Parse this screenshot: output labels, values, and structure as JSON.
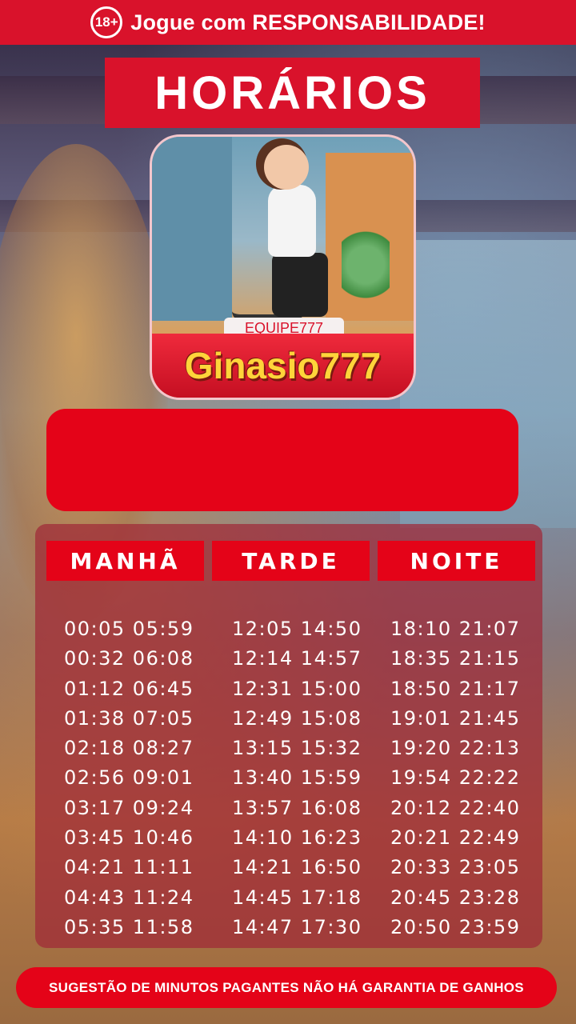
{
  "top_bar": {
    "age_badge": "18+",
    "text": "Jogue com RESPONSABILIDADE!"
  },
  "title": "HORÁRIOS",
  "logo": {
    "ribbon": "EQUIPE777",
    "name": "Ginasio777"
  },
  "colors": {
    "brand_red": "#d9122b",
    "logo_text": "#ffd43a"
  },
  "schedule": {
    "columns": [
      {
        "label": "MANHÃ",
        "times": [
          "00:05 05:59",
          "00:32 06:08",
          "01:12 06:45",
          "01:38 07:05",
          "02:18 08:27",
          "02:56 09:01",
          "03:17 09:24",
          "03:45 10:46",
          "04:21 11:11",
          "04:43 11:24",
          "05:35 11:58"
        ]
      },
      {
        "label": "TARDE",
        "times": [
          "12:05 14:50",
          "12:14 14:57",
          "12:31 15:00",
          "12:49 15:08",
          "13:15 15:32",
          "13:40 15:59",
          "13:57 16:08",
          "14:10 16:23",
          "14:21 16:50",
          "14:45 17:18",
          "14:47 17:30"
        ]
      },
      {
        "label": "NOITE",
        "times": [
          "18:10 21:07",
          "18:35 21:15",
          "18:50 21:17",
          "19:01 21:45",
          "19:20 22:13",
          "19:54 22:22",
          "20:12 22:40",
          "20:21 22:49",
          "20:33 23:05",
          "20:45 23:28",
          "20:50 23:59"
        ]
      }
    ]
  },
  "footer": "SUGESTÃO DE MINUTOS PAGANTES NÃO HÁ GARANTIA DE GANHOS"
}
